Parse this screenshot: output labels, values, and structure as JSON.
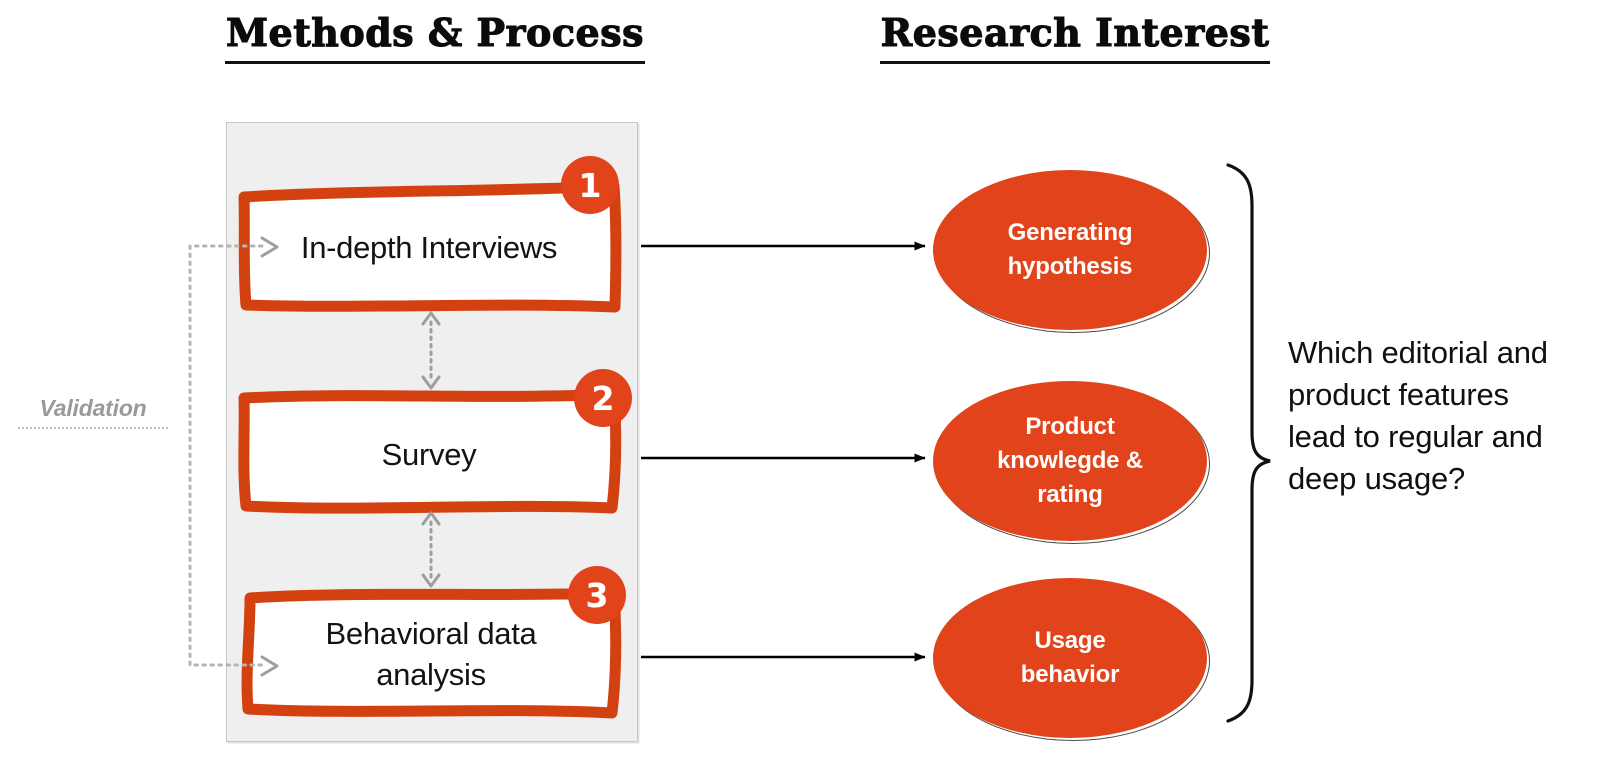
{
  "titles": {
    "methods": "Methods & Process",
    "research": "Research Interest"
  },
  "methods": {
    "panel_label": "methods-panel",
    "steps": [
      {
        "number": "1",
        "label": "In-depth Interviews"
      },
      {
        "number": "2",
        "label": "Survey"
      },
      {
        "number": "3",
        "label": "Behavioral data\nanalysis"
      }
    ]
  },
  "validation": {
    "label": "Validation"
  },
  "research": {
    "outcomes": [
      {
        "label": "Generating\nhypothesis"
      },
      {
        "label": "Product\nknowlegde &\nrating"
      },
      {
        "label": "Usage\nbehavior"
      }
    ],
    "question": "Which editorial and product features lead to regular and deep usage?"
  },
  "colors": {
    "accent": "#E1431B",
    "panel": "#efefef",
    "panel_border": "#c8c8c8",
    "text": "#101010",
    "muted": "#9a9a9a",
    "arrow": "#000000",
    "dotted_arrow": "#9e9e9e"
  },
  "icons": {
    "validation_arrow": "arrow-right-icon",
    "step_link_arrow": "double-headed-arrow-icon",
    "flow_arrow": "arrow-right-icon",
    "grouping": "curly-brace-icon"
  }
}
